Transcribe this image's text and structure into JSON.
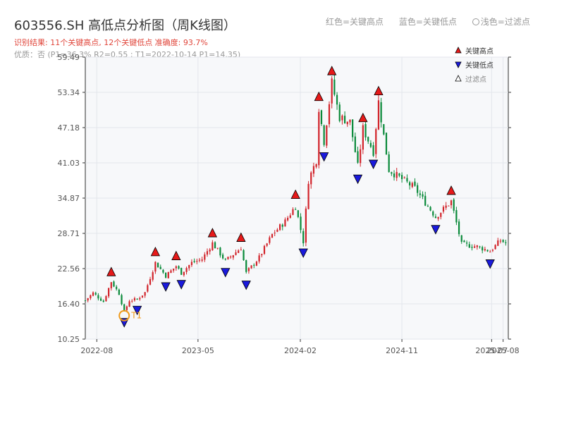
{
  "title": "603556.SH 高低点分析图（周K线图）",
  "subtitle": "识别结果: 11个关键高点, 12个关键低点  准确度: 93.7%",
  "quality_line": "优质：否  (P1=36.3%  R2=0.55  ; T1=2022-10-14 P1=14.35)",
  "top_legend": {
    "red": "红色=关键高点",
    "blue": "蓝色=关键低点",
    "light": "浅色=过滤点"
  },
  "colors": {
    "up": "#d2232a",
    "down": "#0a8a3a",
    "high_marker": "#e61919",
    "low_marker": "#1a1adc",
    "t1": "#f09a1a",
    "plot_bg": "#f7f8fa"
  },
  "chart_data": {
    "type": "candlestick",
    "ylim": [
      10.25,
      59.49
    ],
    "y_ticks": [
      "10.25",
      "16.40",
      "22.56",
      "28.71",
      "34.87",
      "41.03",
      "47.18",
      "53.34",
      "59.49"
    ],
    "x_ticks": [
      "2022-08",
      "2023-05",
      "2024-02",
      "2024-11",
      "2025-08",
      "2025-07"
    ],
    "legend": {
      "position": "top-right",
      "items": [
        {
          "label": "关键高点",
          "marker": "triangle-up",
          "color": "#e61919"
        },
        {
          "label": "关键低点",
          "marker": "triangle-down",
          "color": "#1a1adc"
        },
        {
          "label": "过滤点",
          "marker": "triangle-up-hollow",
          "color": "#ffffff"
        }
      ]
    },
    "key_highs": [
      {
        "date": "2022-09-09",
        "price": 20.8
      },
      {
        "date": "2023-01-06",
        "price": 24.3
      },
      {
        "date": "2023-03-03",
        "price": 23.6
      },
      {
        "date": "2023-06-09",
        "price": 27.6
      },
      {
        "date": "2023-08-25",
        "price": 26.8
      },
      {
        "date": "2024-01-19",
        "price": 34.3
      },
      {
        "date": "2024-03-22",
        "price": 51.4
      },
      {
        "date": "2024-04-26",
        "price": 55.9
      },
      {
        "date": "2024-07-19",
        "price": 47.7
      },
      {
        "date": "2024-08-30",
        "price": 52.4
      },
      {
        "date": "2025-03-14",
        "price": 35.0
      }
    ],
    "key_lows": [
      {
        "date": "2022-10-14",
        "price": 14.35
      },
      {
        "date": "2022-11-18",
        "price": 16.5
      },
      {
        "date": "2023-02-03",
        "price": 20.6
      },
      {
        "date": "2023-03-17",
        "price": 21.0
      },
      {
        "date": "2023-07-14",
        "price": 23.1
      },
      {
        "date": "2023-09-08",
        "price": 20.9
      },
      {
        "date": "2024-02-09",
        "price": 26.5
      },
      {
        "date": "2024-04-05",
        "price": 43.3
      },
      {
        "date": "2024-07-05",
        "price": 39.4
      },
      {
        "date": "2024-08-16",
        "price": 42.0
      },
      {
        "date": "2025-01-31",
        "price": 30.6
      },
      {
        "date": "2025-06-27",
        "price": 24.6
      }
    ],
    "t1": {
      "label": "T1",
      "date": "2022-10-14",
      "price": 14.35
    },
    "price_path": [
      [
        "2022-07-01",
        17.0
      ],
      [
        "2022-07-22",
        18.3
      ],
      [
        "2022-08-19",
        16.8
      ],
      [
        "2022-09-09",
        20.3
      ],
      [
        "2022-09-30",
        18.2
      ],
      [
        "2022-10-14",
        15.0
      ],
      [
        "2022-10-28",
        17.0
      ],
      [
        "2022-11-18",
        17.2
      ],
      [
        "2022-12-09",
        18.4
      ],
      [
        "2023-01-06",
        23.6
      ],
      [
        "2023-02-03",
        21.3
      ],
      [
        "2023-03-03",
        23.0
      ],
      [
        "2023-03-17",
        21.8
      ],
      [
        "2023-04-14",
        23.6
      ],
      [
        "2023-05-12",
        24.2
      ],
      [
        "2023-06-09",
        27.0
      ],
      [
        "2023-07-14",
        23.9
      ],
      [
        "2023-08-25",
        26.2
      ],
      [
        "2023-09-08",
        21.8
      ],
      [
        "2023-10-13",
        24.5
      ],
      [
        "2023-11-17",
        28.5
      ],
      [
        "2023-12-22",
        30.8
      ],
      [
        "2024-01-19",
        33.5
      ],
      [
        "2024-02-09",
        27.3
      ],
      [
        "2024-02-23",
        38.0
      ],
      [
        "2024-03-15",
        41.5
      ],
      [
        "2024-03-22",
        50.7
      ],
      [
        "2024-04-05",
        44.8
      ],
      [
        "2024-04-26",
        55.0
      ],
      [
        "2024-05-17",
        49.0
      ],
      [
        "2024-06-14",
        48.2
      ],
      [
        "2024-07-05",
        40.4
      ],
      [
        "2024-07-19",
        47.0
      ],
      [
        "2024-08-16",
        43.0
      ],
      [
        "2024-08-30",
        51.7
      ],
      [
        "2024-09-27",
        39.8
      ],
      [
        "2024-10-25",
        38.5
      ],
      [
        "2024-12-06",
        36.6
      ],
      [
        "2025-01-31",
        31.6
      ],
      [
        "2025-03-14",
        34.3
      ],
      [
        "2025-04-11",
        26.8
      ],
      [
        "2025-05-23",
        26.4
      ],
      [
        "2025-06-27",
        25.6
      ],
      [
        "2025-07-25",
        27.5
      ],
      [
        "2025-08-08",
        27.0
      ]
    ]
  }
}
